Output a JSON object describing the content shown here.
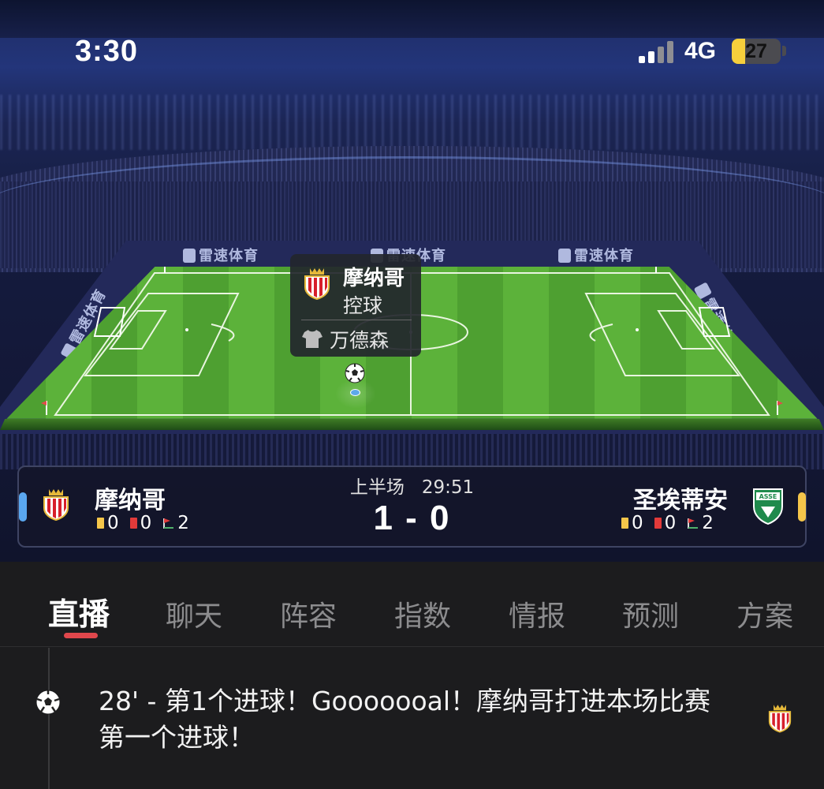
{
  "status_bar": {
    "time": "3:30",
    "network": "4G",
    "battery": "27",
    "battery_level": 0.27
  },
  "ads": [
    "雷速体育",
    "雷速体育",
    "雷速体育",
    "雷速体育",
    "雷速体育"
  ],
  "possession_popup": {
    "team": "摩纳哥",
    "action": "控球",
    "player": "万德森"
  },
  "match": {
    "period": "上半场",
    "clock": "29:51",
    "score": "1 - 0",
    "home": {
      "name": "摩纳哥",
      "yellow": "0",
      "red": "0",
      "corners": "2",
      "color": "#5aa7f0"
    },
    "away": {
      "name": "圣埃蒂安",
      "yellow": "0",
      "red": "0",
      "corners": "2",
      "color": "#f5c64a"
    }
  },
  "tabs": [
    "直播",
    "聊天",
    "阵容",
    "指数",
    "情报",
    "预测",
    "方案"
  ],
  "active_tab": 0,
  "feed": [
    {
      "text": "28' - 第1个进球！Gooooooal！摩纳哥打进本场比赛第一个进球！",
      "icon": "soccer-ball-icon",
      "team_crest": "monaco-crest-icon"
    }
  ]
}
